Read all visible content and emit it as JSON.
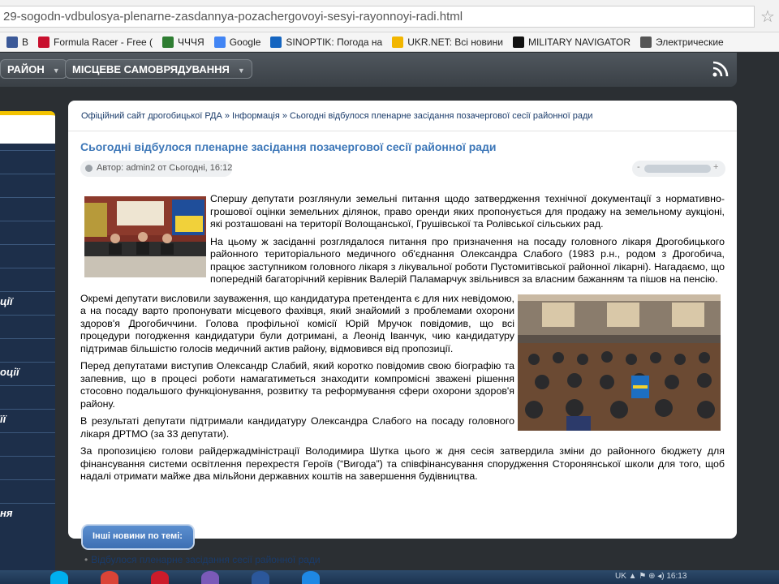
{
  "browser": {
    "url": "29-sogodn-vdbulosya-plenarne-zasdannya-pozachergovoyi-sesyi-rayonnoyi-radi.html",
    "bookmarks": [
      {
        "label": "В",
        "color": "#3b5998",
        "icon": "facebook-icon"
      },
      {
        "label": "Formula Racer - Free (",
        "color": "#c8102e",
        "icon": "racer-icon"
      },
      {
        "label": "ЧЧЧЯ",
        "color": "#2e7d32",
        "icon": "leaf-icon"
      },
      {
        "label": "Google",
        "color": "#4285f4",
        "icon": "google-icon"
      },
      {
        "label": "SINOPTIK: Погода на",
        "color": "#1565c0",
        "icon": "thermometer-icon"
      },
      {
        "label": "UKR.NET: Всі новини",
        "color": "#f2b600",
        "icon": "ukrnet-icon"
      },
      {
        "label": "MILITARY NAVIGATOR",
        "color": "#111111",
        "icon": "mn-icon"
      },
      {
        "label": "Электрические",
        "color": "#555555",
        "icon": "tooth-icon"
      }
    ]
  },
  "nav": {
    "items": [
      {
        "label": "РАЙОН"
      },
      {
        "label": "МІСЦЕВЕ САМОВРЯДУВАННЯ"
      }
    ]
  },
  "sidebar": {
    "rows": [
      "",
      "",
      "",
      "",
      "",
      "",
      "ції",
      "",
      "",
      "оції",
      "",
      "її",
      "",
      "",
      "",
      "ня"
    ]
  },
  "article": {
    "breadcrumb": "Офіційний сайт дрогобицької РДА » Інформація » Сьогодні відбулося пленарне засідання позачергової сесії районної ради",
    "title": "Сьогодні відбулося пленарне засідання позачергової сесії районної ради",
    "meta": "Автор: admin2 от Сьогодні, 16:12",
    "rating_minus": "-",
    "rating_plus": "+",
    "paragraphs": [
      "Спершу депутати розглянули земельні питання щодо затвердження технічної документації з нормативно-грошової оцінки земельних ділянок, право оренди яких пропонується для продажу на земельному аукціоні, які розташовані на території Волощанської, Грушівської та Ролівської сільських рад.",
      "На цьому ж засіданні розглядалося питання про призначення на посаду головного лікаря Дрогобицького районного територіального медичного об'єднання Олександра Слабого (1983 р.н., родом з Дрогобича, працює заступником головного лікаря з лікувальної роботи Пустомитівської районної лікарні). Нагадаємо, що попередній багаторічний керівник Валерій Паламарчук звільнився за власним бажанням та пішов на пенсію.",
      "Окремі депутати висловили зауваження, що кандидатура претендента є для них невідомою, а на посаду варто пропонувати місцевого фахівця, який знайомий з проблемами охорони здоров'я Дрогобиччини. Голова профільної комісії Юрій Мручок повідомив, що всі процедури погодження кандидатури були дотримані, а Леонід Іванчук, чию кандидатуру підтримав більшістю голосів медичний актив району, відмовився від пропозиції.",
      "Перед депутатами виступив Олександр Слабий, який коротко повідомив свою біографію та запевнив, що в процесі роботи намагатиметься знаходити компромісні зважені рішення стосовно подальшого функціонування, розвитку та реформування сфери охорони здоров'я району.",
      "В результаті депутати підтримали кандидатуру Олександра Слабого на посаду головного лікаря ДРТМО (за 33 депутати).",
      "За пропозицією голови райдержадміністрації Володимира Шутка цього ж дня сесія затвердила зміни до районного бюджету для фінансування системи освітлення перехрестя Героїв (“Вигода”) та співфінансування спорудження Сторонянської школи для того, щоб надалі отримати майже два мільйони державних коштів на завершення будівництва."
    ],
    "more_news_label": "Інші новини по темі:",
    "related": [
      "Відбулося пленарне засідання сесії районної ради"
    ]
  },
  "taskbar": {
    "tray_text": "UK  ▲  ⚑  ⊕  ◂) 16:13"
  }
}
